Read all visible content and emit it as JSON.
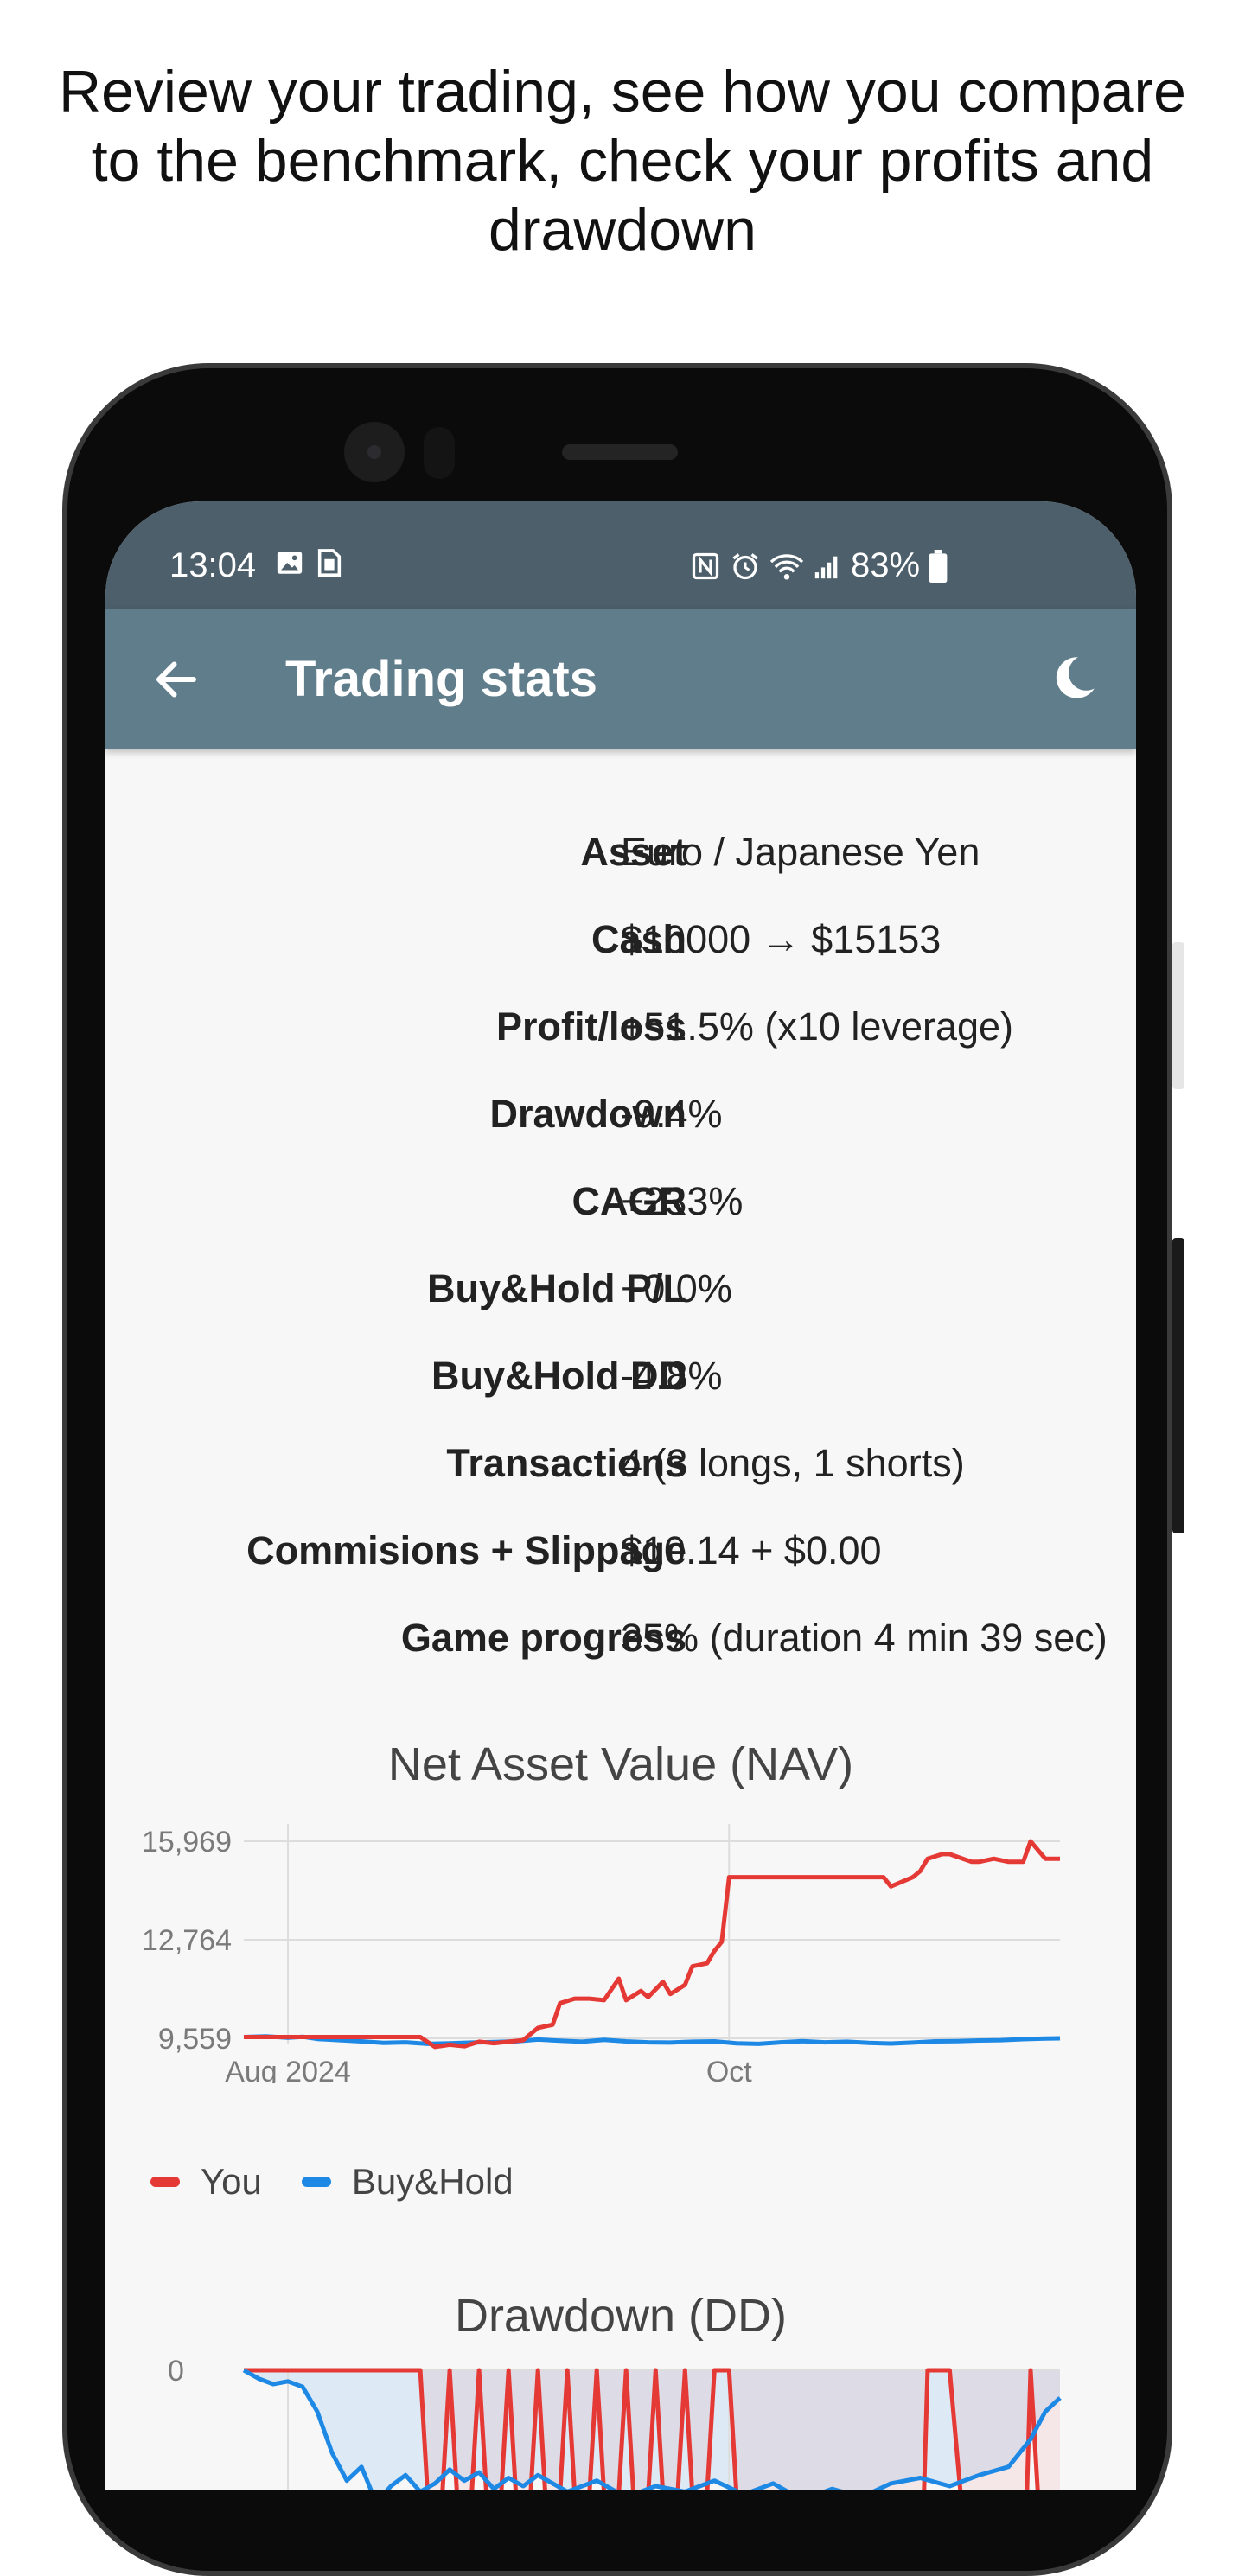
{
  "caption": {
    "line1": "Review your trading, see how you compare",
    "line2": "to the benchmark, check your profits and",
    "line3": "drawdown"
  },
  "status_bar": {
    "time": "13:04",
    "battery": "83%",
    "left_icons": [
      "image-icon",
      "sim-icon"
    ],
    "right_icons": [
      "nfc-icon",
      "alarm-icon",
      "wifi-icon",
      "signal-icon",
      "battery-icon"
    ]
  },
  "app_bar": {
    "title": "Trading stats",
    "back_icon": "arrow-left-icon",
    "theme_icon": "moon-icon"
  },
  "stats": [
    {
      "label": "Asset",
      "value": "Euro / Japanese Yen"
    },
    {
      "label": "Cash",
      "value": "$10000 → $15153"
    },
    {
      "label": "Profit/loss",
      "value": "+51.5% (x10 leverage)"
    },
    {
      "label": "Drawdown",
      "value": "-9.4%"
    },
    {
      "label": "CAGR",
      "value": "+233%"
    },
    {
      "label": "Buy&Hold P/L",
      "value": "+0.0%"
    },
    {
      "label": "Buy&Hold DD",
      "value": "-4.8%"
    },
    {
      "label": "Transactions",
      "value": "4 (3 longs, 1 shorts)"
    },
    {
      "label": "Commisions + Slippage",
      "value": "$10.14 + $0.00"
    },
    {
      "label": "Game progress",
      "value": "35% (duration 4 min 39 sec)"
    }
  ],
  "colors": {
    "you": "#e53935",
    "buy_hold": "#1e88e5",
    "app_bar": "#607d8b",
    "status_bar": "#4c5f6b"
  },
  "chart_data": [
    {
      "type": "line",
      "title": "Net Asset Value (NAV)",
      "y_ticks": [
        "15,969",
        "12,764",
        "9,559"
      ],
      "y_tick_values": [
        15969,
        12764,
        9559
      ],
      "ylim": [
        9559,
        15969
      ],
      "x_ticks": [
        "Aug 2024",
        "Oct"
      ],
      "x_tick_days": [
        6,
        66
      ],
      "xlim": [
        0,
        111
      ],
      "grid": true,
      "legend_position": "bottom-left",
      "series": [
        {
          "name": "You",
          "color": "#e53935",
          "x": [
            0,
            10,
            20,
            24,
            26,
            28,
            30,
            32,
            34,
            36,
            38,
            40,
            42,
            43,
            45,
            47,
            49,
            51,
            52,
            54,
            55,
            57,
            58,
            60,
            61,
            63,
            64,
            65,
            66,
            87,
            88,
            91,
            92,
            93,
            95,
            96,
            99,
            100,
            102,
            104,
            106,
            107,
            109,
            111
          ],
          "y": [
            9600,
            9600,
            9600,
            9600,
            9280,
            9350,
            9300,
            9450,
            9400,
            9450,
            9500,
            9900,
            10000,
            10700,
            10850,
            10850,
            10800,
            11500,
            10800,
            11100,
            10900,
            11400,
            11000,
            11300,
            11900,
            12000,
            12400,
            12700,
            14800,
            14800,
            14500,
            14800,
            15000,
            15400,
            15550,
            15550,
            15300,
            15300,
            15400,
            15300,
            15300,
            15969,
            15400,
            15400
          ]
        },
        {
          "name": "Buy&Hold",
          "color": "#1e88e5",
          "x": [
            0,
            3,
            6,
            8,
            10,
            13,
            16,
            19,
            22,
            25,
            28,
            31,
            34,
            37,
            40,
            43,
            46,
            49,
            52,
            55,
            58,
            61,
            64,
            67,
            70,
            73,
            76,
            79,
            82,
            85,
            88,
            91,
            94,
            97,
            100,
            103,
            106,
            109,
            111
          ],
          "y": [
            9600,
            9620,
            9580,
            9610,
            9540,
            9500,
            9460,
            9410,
            9430,
            9380,
            9400,
            9420,
            9440,
            9460,
            9520,
            9480,
            9450,
            9510,
            9460,
            9430,
            9420,
            9450,
            9460,
            9400,
            9380,
            9430,
            9470,
            9430,
            9450,
            9410,
            9390,
            9420,
            9460,
            9470,
            9490,
            9500,
            9530,
            9550,
            9560
          ]
        }
      ]
    },
    {
      "type": "line",
      "title": "Drawdown (DD)",
      "y_ticks": [
        "0"
      ],
      "ylim": [
        -9.4,
        0
      ],
      "grid": true,
      "series": [
        {
          "name": "You",
          "color": "#e53935",
          "x": [
            0,
            5,
            6,
            24,
            26,
            28,
            30,
            32,
            34,
            36,
            38,
            40,
            42,
            44,
            46,
            48,
            50,
            52,
            54,
            56,
            58,
            60,
            62,
            64,
            66,
            68,
            72,
            74,
            76,
            78,
            80,
            82,
            84,
            86,
            88,
            91,
            92,
            93,
            95,
            96,
            99,
            100,
            102,
            104,
            106,
            107,
            109,
            111
          ],
          "y": [
            0,
            0,
            0,
            0,
            -9,
            0,
            -9,
            0,
            -9,
            0,
            -9,
            0,
            -9,
            0,
            -9,
            0,
            -9,
            0,
            -9,
            0,
            -9,
            0,
            -9,
            0,
            0,
            -9,
            -9,
            -9,
            -9,
            -9,
            -9,
            -9,
            -9,
            -9,
            -9,
            -9,
            -9,
            0,
            0,
            0,
            -9,
            -9,
            -9,
            -9,
            -9,
            0,
            -9,
            -9
          ]
        },
        {
          "name": "Buy&Hold",
          "color": "#1e88e5",
          "x": [
            0,
            2,
            4,
            6,
            8,
            10,
            12,
            14,
            16,
            18,
            20,
            22,
            24,
            26,
            28,
            30,
            32,
            34,
            36,
            38,
            40,
            44,
            48,
            52,
            56,
            60,
            64,
            68,
            72,
            76,
            80,
            84,
            88,
            92,
            96,
            100,
            104,
            107,
            109,
            111
          ],
          "y": [
            0,
            -0.3,
            -0.5,
            -0.4,
            -0.6,
            -1.5,
            -3.0,
            -4.0,
            -3.5,
            -4.8,
            -4.2,
            -3.8,
            -4.4,
            -4.1,
            -3.6,
            -4.0,
            -3.7,
            -4.3,
            -3.9,
            -4.2,
            -3.8,
            -4.4,
            -4.0,
            -4.6,
            -4.2,
            -4.4,
            -4.0,
            -4.5,
            -4.1,
            -4.7,
            -4.3,
            -4.6,
            -4.1,
            -3.9,
            -4.2,
            -3.8,
            -3.5,
            -2.5,
            -1.5,
            -1.0
          ]
        }
      ]
    }
  ]
}
